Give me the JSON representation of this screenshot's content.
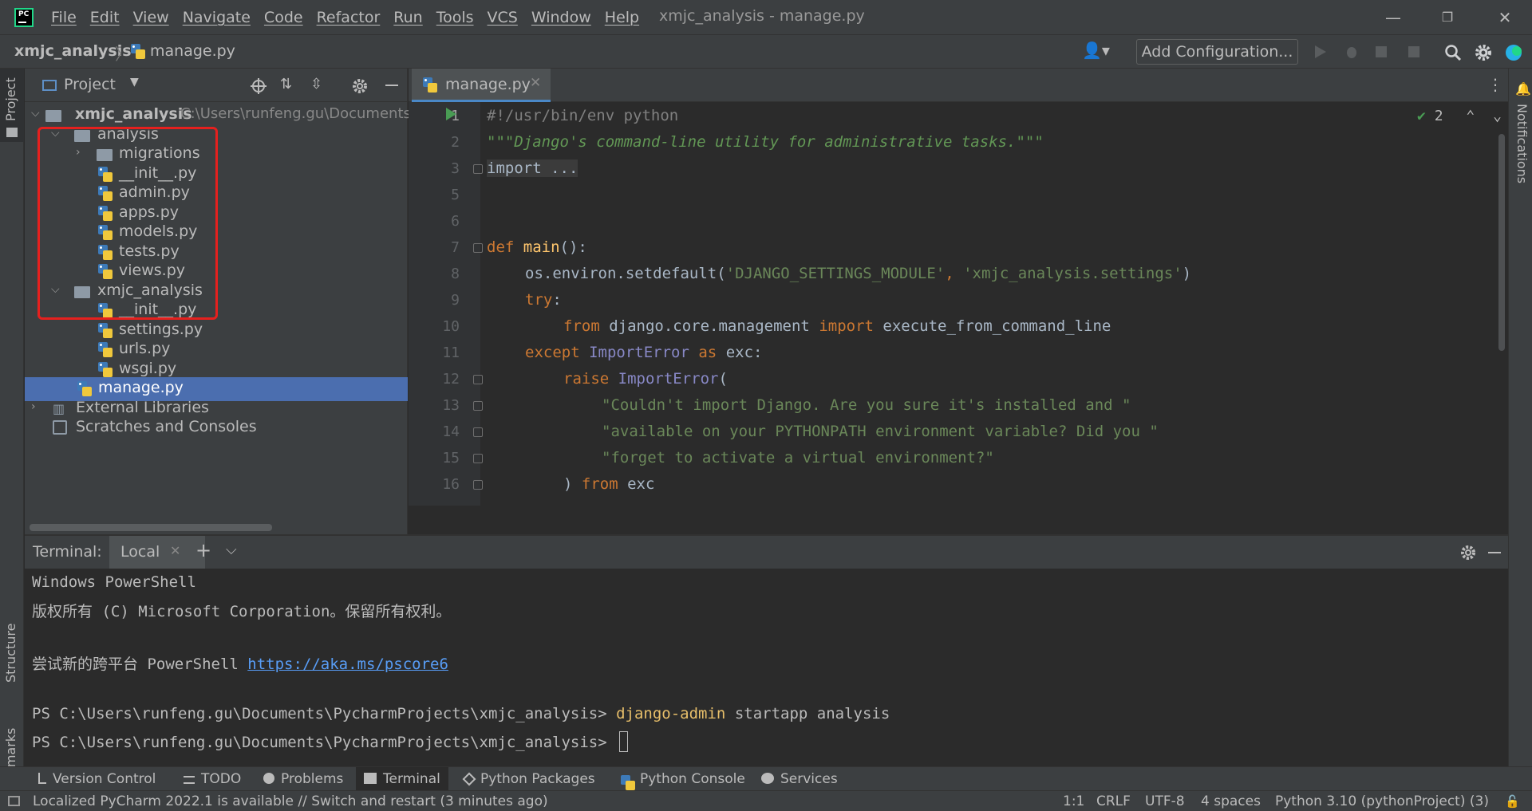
{
  "window": {
    "title": "xmjc_analysis - manage.py"
  },
  "menu": [
    "File",
    "Edit",
    "View",
    "Navigate",
    "Code",
    "Refactor",
    "Run",
    "Tools",
    "VCS",
    "Window",
    "Help"
  ],
  "breadcrumb": {
    "project": "xmjc_analysis",
    "file": "manage.py"
  },
  "toolbar": {
    "add_configuration": "Add Configuration..."
  },
  "left_strip": {
    "project_tab": "Project",
    "structure_tab": "Structure",
    "bookmarks_tab": "Bookmarks"
  },
  "right_strip": {
    "notifications_tab": "Notifications"
  },
  "project_panel": {
    "title": "Project",
    "root": {
      "label": "xmjc_analysis",
      "path": "C:\\Users\\runfeng.gu\\Documents\\P"
    },
    "items": [
      {
        "label": "analysis",
        "type": "folder",
        "expanded": true
      },
      {
        "label": "migrations",
        "type": "folder",
        "expanded": false
      },
      {
        "label": "__init__.py",
        "type": "python"
      },
      {
        "label": "admin.py",
        "type": "python"
      },
      {
        "label": "apps.py",
        "type": "python"
      },
      {
        "label": "models.py",
        "type": "python"
      },
      {
        "label": "tests.py",
        "type": "python"
      },
      {
        "label": "views.py",
        "type": "python"
      },
      {
        "label": "xmjc_analysis",
        "type": "folder",
        "expanded": true
      },
      {
        "label": "__init__.py",
        "type": "python"
      },
      {
        "label": "settings.py",
        "type": "python"
      },
      {
        "label": "urls.py",
        "type": "python"
      },
      {
        "label": "wsgi.py",
        "type": "python"
      },
      {
        "label": "manage.py",
        "type": "python",
        "selected": true
      },
      {
        "label": "External Libraries",
        "type": "library"
      },
      {
        "label": "Scratches and Consoles",
        "type": "scratches"
      }
    ],
    "highlight_color": "#e6201e"
  },
  "editor": {
    "tab": "manage.py",
    "inspection_count": "2",
    "line_numbers": [
      "1",
      "2",
      "3",
      "5",
      "6",
      "7",
      "8",
      "9",
      "10",
      "11",
      "12",
      "13",
      "14",
      "15",
      "16"
    ],
    "lines": {
      "l1": "#!/usr/bin/env python",
      "l2": "\"\"\"Django's command-line utility for administrative tasks.\"\"\"",
      "l3": "import ...",
      "l7_kw": "def ",
      "l7_fn": "main",
      "l7_rest": "():",
      "l8_a": "os.environ.setdefault(",
      "l8_s1": "'DJANGO_SETTINGS_MODULE'",
      "l8_c": ", ",
      "l8_s2": "'xmjc_analysis.settings'",
      "l8_e": ")",
      "l9_kw": "try",
      "l9_e": ":",
      "l10_kw1": "from ",
      "l10_mod": "django.core.management ",
      "l10_kw2": "import ",
      "l10_name": "execute_from_command_line",
      "l11_kw": "except ",
      "l11_cls": "ImportError ",
      "l11_as": "as ",
      "l11_e": "exc:",
      "l12_kw": "raise ",
      "l12_cls": "ImportError",
      "l12_e": "(",
      "l13": "\"Couldn't import Django. Are you sure it's installed and \"",
      "l14": "\"available on your PYTHONPATH environment variable? Did you \"",
      "l15": "\"forget to activate a virtual environment?\"",
      "l16_a": ") ",
      "l16_kw": "from ",
      "l16_e": "exc"
    }
  },
  "terminal": {
    "label": "Terminal:",
    "tab": "Local",
    "lines": {
      "t1": "Windows PowerShell",
      "t2": "版权所有 (C) Microsoft Corporation。保留所有权利。",
      "t3_prefix": "尝试新的跨平台 PowerShell ",
      "t3_link": "https://aka.ms/pscore6",
      "t4_prompt": "PS C:\\Users\\runfeng.gu\\Documents\\PycharmProjects\\xmjc_analysis> ",
      "t4_cmd": "django-admin",
      "t4_rest": " startapp analysis",
      "t5_prompt": "PS C:\\Users\\runfeng.gu\\Documents\\PycharmProjects\\xmjc_analysis> "
    }
  },
  "bottom_tabs": {
    "version_control": "Version Control",
    "todo": "TODO",
    "problems": "Problems",
    "terminal": "Terminal",
    "python_packages": "Python Packages",
    "python_console": "Python Console",
    "services": "Services"
  },
  "status": {
    "message": "Localized PyCharm 2022.1 is available // Switch and restart (3 minutes ago)",
    "position": "1:1",
    "line_sep": "CRLF",
    "encoding": "UTF-8",
    "indent": "4 spaces",
    "interpreter": "Python 3.10 (pythonProject) (3)"
  }
}
